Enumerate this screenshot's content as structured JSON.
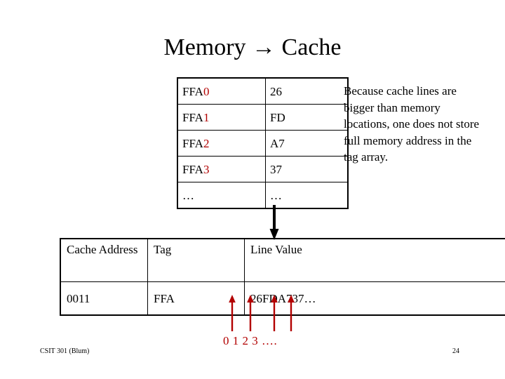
{
  "slide": {
    "title": "Memory → Cache",
    "arrow_color": "#b20000",
    "text_color": "#000000"
  },
  "memory_table": {
    "rows": [
      {
        "addr_prefix": "FFA",
        "addr_offset": "0",
        "value": "26"
      },
      {
        "addr_prefix": "FFA",
        "addr_offset": "1",
        "value": "FD"
      },
      {
        "addr_prefix": "FFA",
        "addr_offset": "2",
        "value": "A7"
      },
      {
        "addr_prefix": "FFA",
        "addr_offset": "3",
        "value": "37"
      },
      {
        "addr_prefix": "…",
        "addr_offset": "",
        "value": "…"
      }
    ]
  },
  "note": {
    "text": "Because cache lines are bigger than memory locations, one does not store full memory address in the tag array."
  },
  "cache_table": {
    "headers": {
      "col1": "Cache Address",
      "col2": "Tag",
      "col3": "Line Value"
    },
    "row": {
      "cache_address": "0011",
      "tag": "FFA",
      "line_value": "26FDA737…"
    }
  },
  "offset_labels": {
    "text": "0  1  2  3 …."
  },
  "footer": {
    "course": "CSIT 301 (Blum)",
    "page_number": "24"
  }
}
